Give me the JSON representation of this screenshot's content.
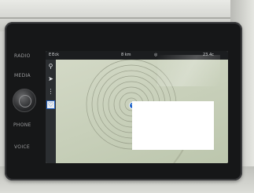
{
  "hardware_buttons": {
    "left": [
      "RADIO",
      "MEDIA",
      "PHONE",
      "VOICE"
    ]
  },
  "status_bar": {
    "left_text": "E Eck",
    "center_text": "8 km",
    "right_text": "23.4c"
  },
  "map": {
    "side_panel_icons": [
      "search-icon",
      "route-icon",
      "more-icon",
      "favourite-heart-icon"
    ]
  },
  "colors": {
    "screen_map": "#c4ccb6",
    "accent_blue": "#1f63c9",
    "bezel": "#161718"
  }
}
